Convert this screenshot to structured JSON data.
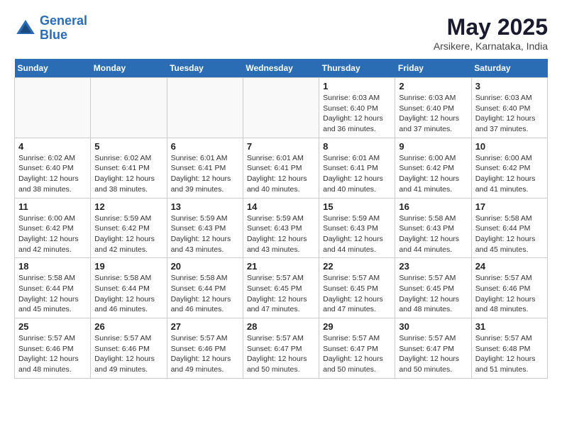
{
  "header": {
    "logo_line1": "General",
    "logo_line2": "Blue",
    "month": "May 2025",
    "location": "Arsikere, Karnataka, India"
  },
  "weekdays": [
    "Sunday",
    "Monday",
    "Tuesday",
    "Wednesday",
    "Thursday",
    "Friday",
    "Saturday"
  ],
  "weeks": [
    [
      {
        "day": "",
        "info": ""
      },
      {
        "day": "",
        "info": ""
      },
      {
        "day": "",
        "info": ""
      },
      {
        "day": "",
        "info": ""
      },
      {
        "day": "1",
        "info": "Sunrise: 6:03 AM\nSunset: 6:40 PM\nDaylight: 12 hours\nand 36 minutes."
      },
      {
        "day": "2",
        "info": "Sunrise: 6:03 AM\nSunset: 6:40 PM\nDaylight: 12 hours\nand 37 minutes."
      },
      {
        "day": "3",
        "info": "Sunrise: 6:03 AM\nSunset: 6:40 PM\nDaylight: 12 hours\nand 37 minutes."
      }
    ],
    [
      {
        "day": "4",
        "info": "Sunrise: 6:02 AM\nSunset: 6:40 PM\nDaylight: 12 hours\nand 38 minutes."
      },
      {
        "day": "5",
        "info": "Sunrise: 6:02 AM\nSunset: 6:41 PM\nDaylight: 12 hours\nand 38 minutes."
      },
      {
        "day": "6",
        "info": "Sunrise: 6:01 AM\nSunset: 6:41 PM\nDaylight: 12 hours\nand 39 minutes."
      },
      {
        "day": "7",
        "info": "Sunrise: 6:01 AM\nSunset: 6:41 PM\nDaylight: 12 hours\nand 40 minutes."
      },
      {
        "day": "8",
        "info": "Sunrise: 6:01 AM\nSunset: 6:41 PM\nDaylight: 12 hours\nand 40 minutes."
      },
      {
        "day": "9",
        "info": "Sunrise: 6:00 AM\nSunset: 6:42 PM\nDaylight: 12 hours\nand 41 minutes."
      },
      {
        "day": "10",
        "info": "Sunrise: 6:00 AM\nSunset: 6:42 PM\nDaylight: 12 hours\nand 41 minutes."
      }
    ],
    [
      {
        "day": "11",
        "info": "Sunrise: 6:00 AM\nSunset: 6:42 PM\nDaylight: 12 hours\nand 42 minutes."
      },
      {
        "day": "12",
        "info": "Sunrise: 5:59 AM\nSunset: 6:42 PM\nDaylight: 12 hours\nand 42 minutes."
      },
      {
        "day": "13",
        "info": "Sunrise: 5:59 AM\nSunset: 6:43 PM\nDaylight: 12 hours\nand 43 minutes."
      },
      {
        "day": "14",
        "info": "Sunrise: 5:59 AM\nSunset: 6:43 PM\nDaylight: 12 hours\nand 43 minutes."
      },
      {
        "day": "15",
        "info": "Sunrise: 5:59 AM\nSunset: 6:43 PM\nDaylight: 12 hours\nand 44 minutes."
      },
      {
        "day": "16",
        "info": "Sunrise: 5:58 AM\nSunset: 6:43 PM\nDaylight: 12 hours\nand 44 minutes."
      },
      {
        "day": "17",
        "info": "Sunrise: 5:58 AM\nSunset: 6:44 PM\nDaylight: 12 hours\nand 45 minutes."
      }
    ],
    [
      {
        "day": "18",
        "info": "Sunrise: 5:58 AM\nSunset: 6:44 PM\nDaylight: 12 hours\nand 45 minutes."
      },
      {
        "day": "19",
        "info": "Sunrise: 5:58 AM\nSunset: 6:44 PM\nDaylight: 12 hours\nand 46 minutes."
      },
      {
        "day": "20",
        "info": "Sunrise: 5:58 AM\nSunset: 6:44 PM\nDaylight: 12 hours\nand 46 minutes."
      },
      {
        "day": "21",
        "info": "Sunrise: 5:57 AM\nSunset: 6:45 PM\nDaylight: 12 hours\nand 47 minutes."
      },
      {
        "day": "22",
        "info": "Sunrise: 5:57 AM\nSunset: 6:45 PM\nDaylight: 12 hours\nand 47 minutes."
      },
      {
        "day": "23",
        "info": "Sunrise: 5:57 AM\nSunset: 6:45 PM\nDaylight: 12 hours\nand 48 minutes."
      },
      {
        "day": "24",
        "info": "Sunrise: 5:57 AM\nSunset: 6:46 PM\nDaylight: 12 hours\nand 48 minutes."
      }
    ],
    [
      {
        "day": "25",
        "info": "Sunrise: 5:57 AM\nSunset: 6:46 PM\nDaylight: 12 hours\nand 48 minutes."
      },
      {
        "day": "26",
        "info": "Sunrise: 5:57 AM\nSunset: 6:46 PM\nDaylight: 12 hours\nand 49 minutes."
      },
      {
        "day": "27",
        "info": "Sunrise: 5:57 AM\nSunset: 6:46 PM\nDaylight: 12 hours\nand 49 minutes."
      },
      {
        "day": "28",
        "info": "Sunrise: 5:57 AM\nSunset: 6:47 PM\nDaylight: 12 hours\nand 50 minutes."
      },
      {
        "day": "29",
        "info": "Sunrise: 5:57 AM\nSunset: 6:47 PM\nDaylight: 12 hours\nand 50 minutes."
      },
      {
        "day": "30",
        "info": "Sunrise: 5:57 AM\nSunset: 6:47 PM\nDaylight: 12 hours\nand 50 minutes."
      },
      {
        "day": "31",
        "info": "Sunrise: 5:57 AM\nSunset: 6:48 PM\nDaylight: 12 hours\nand 51 minutes."
      }
    ]
  ]
}
